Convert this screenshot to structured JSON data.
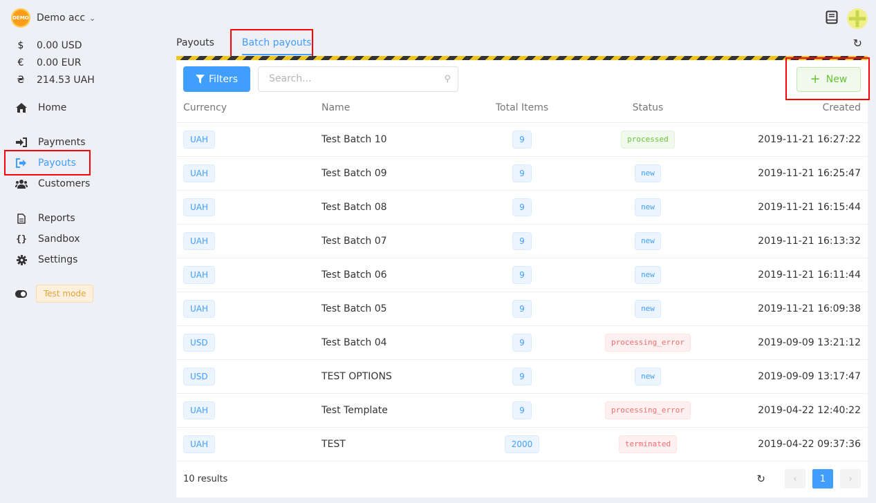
{
  "account": {
    "logo_text": "DEMO",
    "name": "Demo acc"
  },
  "balances": [
    {
      "symbol": "$",
      "amount": "0.00 USD"
    },
    {
      "symbol": "€",
      "amount": "0.00 EUR"
    },
    {
      "symbol": "₴",
      "amount": "214.53 UAH"
    }
  ],
  "nav": {
    "home": "Home",
    "payments": "Payments",
    "payouts": "Payouts",
    "customers": "Customers",
    "reports": "Reports",
    "sandbox": "Sandbox",
    "settings": "Settings"
  },
  "test_mode": "Test mode",
  "tabs": {
    "payouts": "Payouts",
    "batch_payouts": "Batch payouts"
  },
  "toolbar": {
    "filters": "Filters",
    "search_placeholder": "Search...",
    "new": "New"
  },
  "table": {
    "headers": {
      "currency": "Currency",
      "name": "Name",
      "total_items": "Total Items",
      "status": "Status",
      "created": "Created"
    },
    "rows": [
      {
        "currency": "UAH",
        "name": "Test Batch 10",
        "items": "9",
        "status": "processed",
        "created": "2019-11-21 16:27:22"
      },
      {
        "currency": "UAH",
        "name": "Test Batch 09",
        "items": "9",
        "status": "new",
        "created": "2019-11-21 16:25:47"
      },
      {
        "currency": "UAH",
        "name": "Test Batch 08",
        "items": "9",
        "status": "new",
        "created": "2019-11-21 16:15:44"
      },
      {
        "currency": "UAH",
        "name": "Test Batch 07",
        "items": "9",
        "status": "new",
        "created": "2019-11-21 16:13:32"
      },
      {
        "currency": "UAH",
        "name": "Test Batch 06",
        "items": "9",
        "status": "new",
        "created": "2019-11-21 16:11:44"
      },
      {
        "currency": "UAH",
        "name": "Test Batch 05",
        "items": "9",
        "status": "new",
        "created": "2019-11-21 16:09:38"
      },
      {
        "currency": "USD",
        "name": "Test Batch 04",
        "items": "9",
        "status": "processing_error",
        "created": "2019-09-09 13:21:12"
      },
      {
        "currency": "USD",
        "name": "TEST OPTIONS",
        "items": "9",
        "status": "new",
        "created": "2019-09-09 13:17:47"
      },
      {
        "currency": "UAH",
        "name": "Test Template",
        "items": "9",
        "status": "processing_error",
        "created": "2019-04-22 12:40:22"
      },
      {
        "currency": "UAH",
        "name": "TEST",
        "items": "2000",
        "status": "terminated",
        "created": "2019-04-22 09:37:36"
      }
    ]
  },
  "footer": {
    "results": "10 results",
    "current_page": "1",
    "prev": "‹",
    "next": "›"
  },
  "colors": {
    "accent": "#409eff",
    "success": "#67c23a",
    "danger": "#f56c6c",
    "highlight": "#ff0000"
  }
}
